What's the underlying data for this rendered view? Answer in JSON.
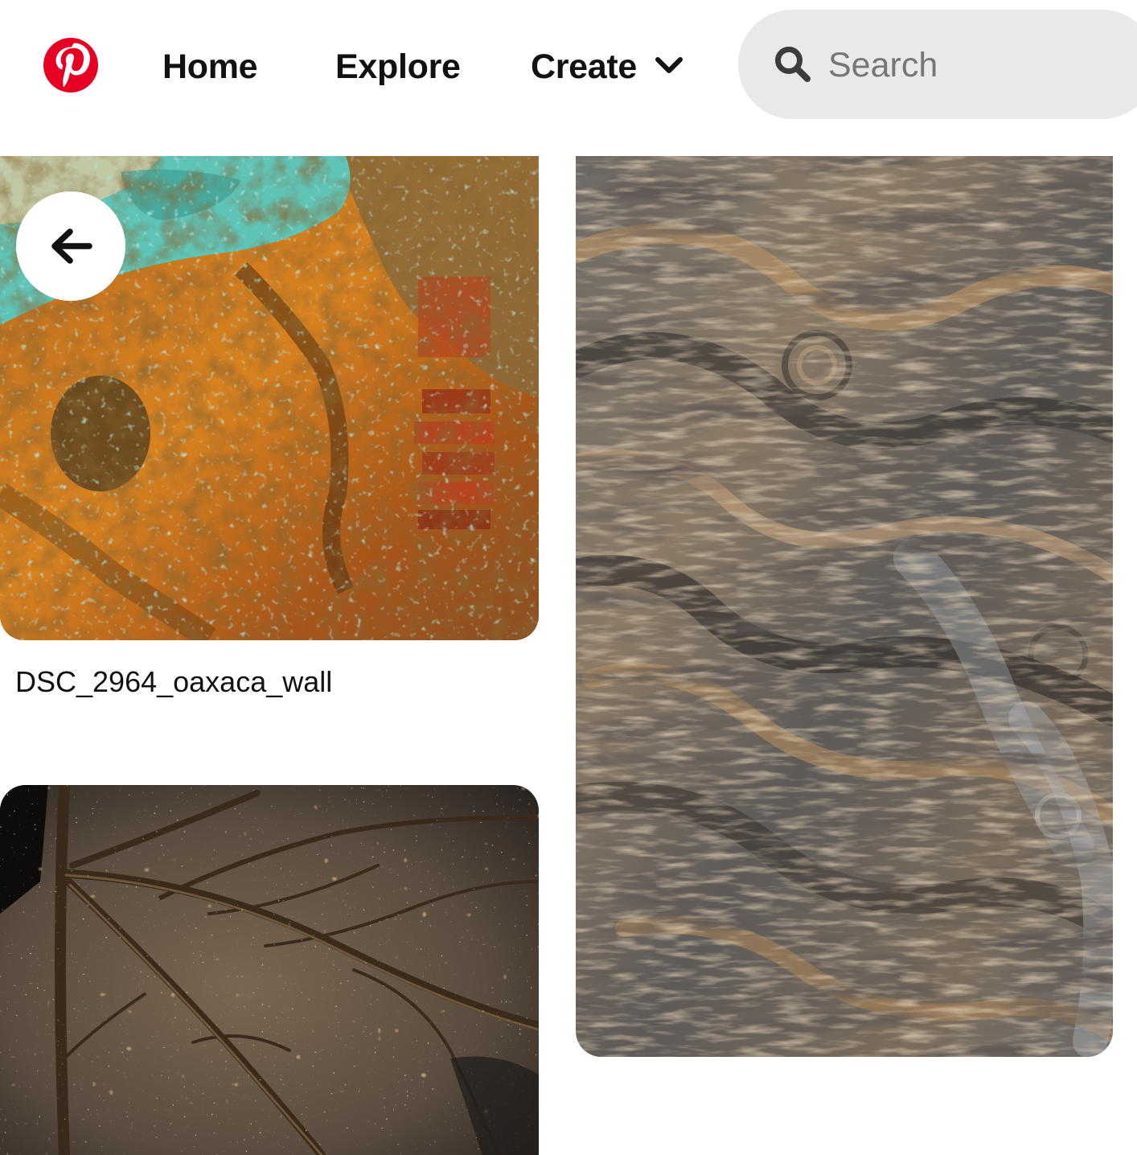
{
  "header": {
    "logo_icon": "pinterest-logo-icon",
    "brand_color": "#e60023",
    "nav": {
      "home_label": "Home",
      "explore_label": "Explore",
      "create_label": "Create",
      "create_icon": "chevron-down-icon"
    },
    "search": {
      "icon": "search-icon",
      "placeholder": "Search",
      "value": ""
    }
  },
  "pins": [
    {
      "kind": "image",
      "subject": "rusty teal and orange textured wall",
      "title": "DSC_2964_oaxaca_wall"
    },
    {
      "kind": "image",
      "subject": "weathered gnarled driftwood grain"
    },
    {
      "kind": "image",
      "subject": "dried leaf covered in water droplets"
    }
  ],
  "overlay": {
    "back_icon": "arrow-left-icon"
  },
  "colors": {
    "page_background": "#ffffff",
    "search_background": "#e9e9e9",
    "text": "#111111",
    "placeholder": "#767676"
  }
}
